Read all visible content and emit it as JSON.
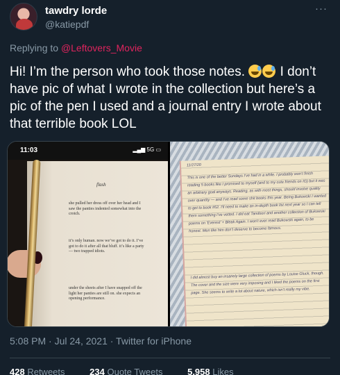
{
  "author": {
    "display_name": "tawdry lorde",
    "handle": "@katiepdf"
  },
  "reply": {
    "prefix": "Replying to",
    "target": "@Leftovers_Movie"
  },
  "tweet": {
    "text_part1": "Hi! I’m the person who took those notes.",
    "text_part2": "I don’t have pic of what I wrote in the collection but here’s a pic of the pen I used and a journal entry I wrote about that terrible book LOL",
    "emoji": "sweat-smile-emoji"
  },
  "media": {
    "left_photo": {
      "status_time": "11:03",
      "status_icons": "5G",
      "page_title": "flash",
      "page_text_1": "she pulled her dress off over her head and I saw the panties indented somewhat into the crotch.",
      "page_text_2": "it’s only human. now we’ve got to do it. I’ve got to do it after all that bluff. it’s like a party— two trapped idiots.",
      "page_text_3": "under the sheets after I have snapped off the light her panties are still on. she expects an opening performance."
    },
    "right_photo": {
      "date": "11/27/20",
      "entry_1": "This is one of the better Sundays I’ve had in a while. I probably won’t finish reading 5 books like I promised to myself (and to my cute friends on IG) but it was an arbitrary goal anyways. Reading, as with most things, should involve quality over quantity — and I’ve read some shit books this year. Being Bukowski I wanted to get to book #52. I’ll need to make an in-depth book list next year so I can tell them something I’ve vetted. I did eat Tandoori and another collection of Bukowski poems on ‘Everest’ + Bleak Again. I won’t ever read Bukowski again, to be honest. Men like him don’t deserve to become famous.",
      "entry_2": "I did almost buy an insanely large collection of poems by Louise Gluck, though. The cover and the size were very imposing and I liked the poems on the first page. She seems to write a lot about nature, which isn’t really my vibe."
    }
  },
  "meta": {
    "timestamp": "5:08 PM · Jul 24, 2021 · Twitter for iPhone"
  },
  "stats": {
    "retweets_count": "428",
    "retweets_label": "Retweets",
    "quotes_count": "234",
    "quotes_label": "Quote Tweets",
    "likes_count": "5,958",
    "likes_label": "Likes"
  },
  "colors": {
    "background": "#15202b",
    "secondary_text": "#8899a6",
    "mention_link": "#e0245e",
    "divider": "#38444d"
  }
}
